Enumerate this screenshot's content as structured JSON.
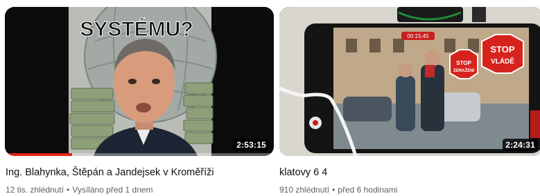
{
  "videos": [
    {
      "thumbnail_text": "SYSTÉMU?",
      "duration": "2:53:15",
      "title": "Ing. Blahynka, Štěpán a Jandejsek v Kroměříži",
      "views": "12 tis. zhlédnutí",
      "time": "Vysíláno před 1 dnem",
      "watched_fraction": 0.25
    },
    {
      "duration": "2:24:31",
      "title": "klatovy 6 4",
      "views": "910 zhlédnutí",
      "time": "před 6 hodinami",
      "stream_clock": "00:15:45",
      "sign_left": "STOP ZDRAŽENÍ",
      "sign_right_top": "STOP",
      "sign_right_bottom": "VLÁDĚ"
    }
  ],
  "meta_separator": "•",
  "colors": {
    "progress": "#e62117",
    "title": "#0f0f0f",
    "meta": "#606060"
  }
}
